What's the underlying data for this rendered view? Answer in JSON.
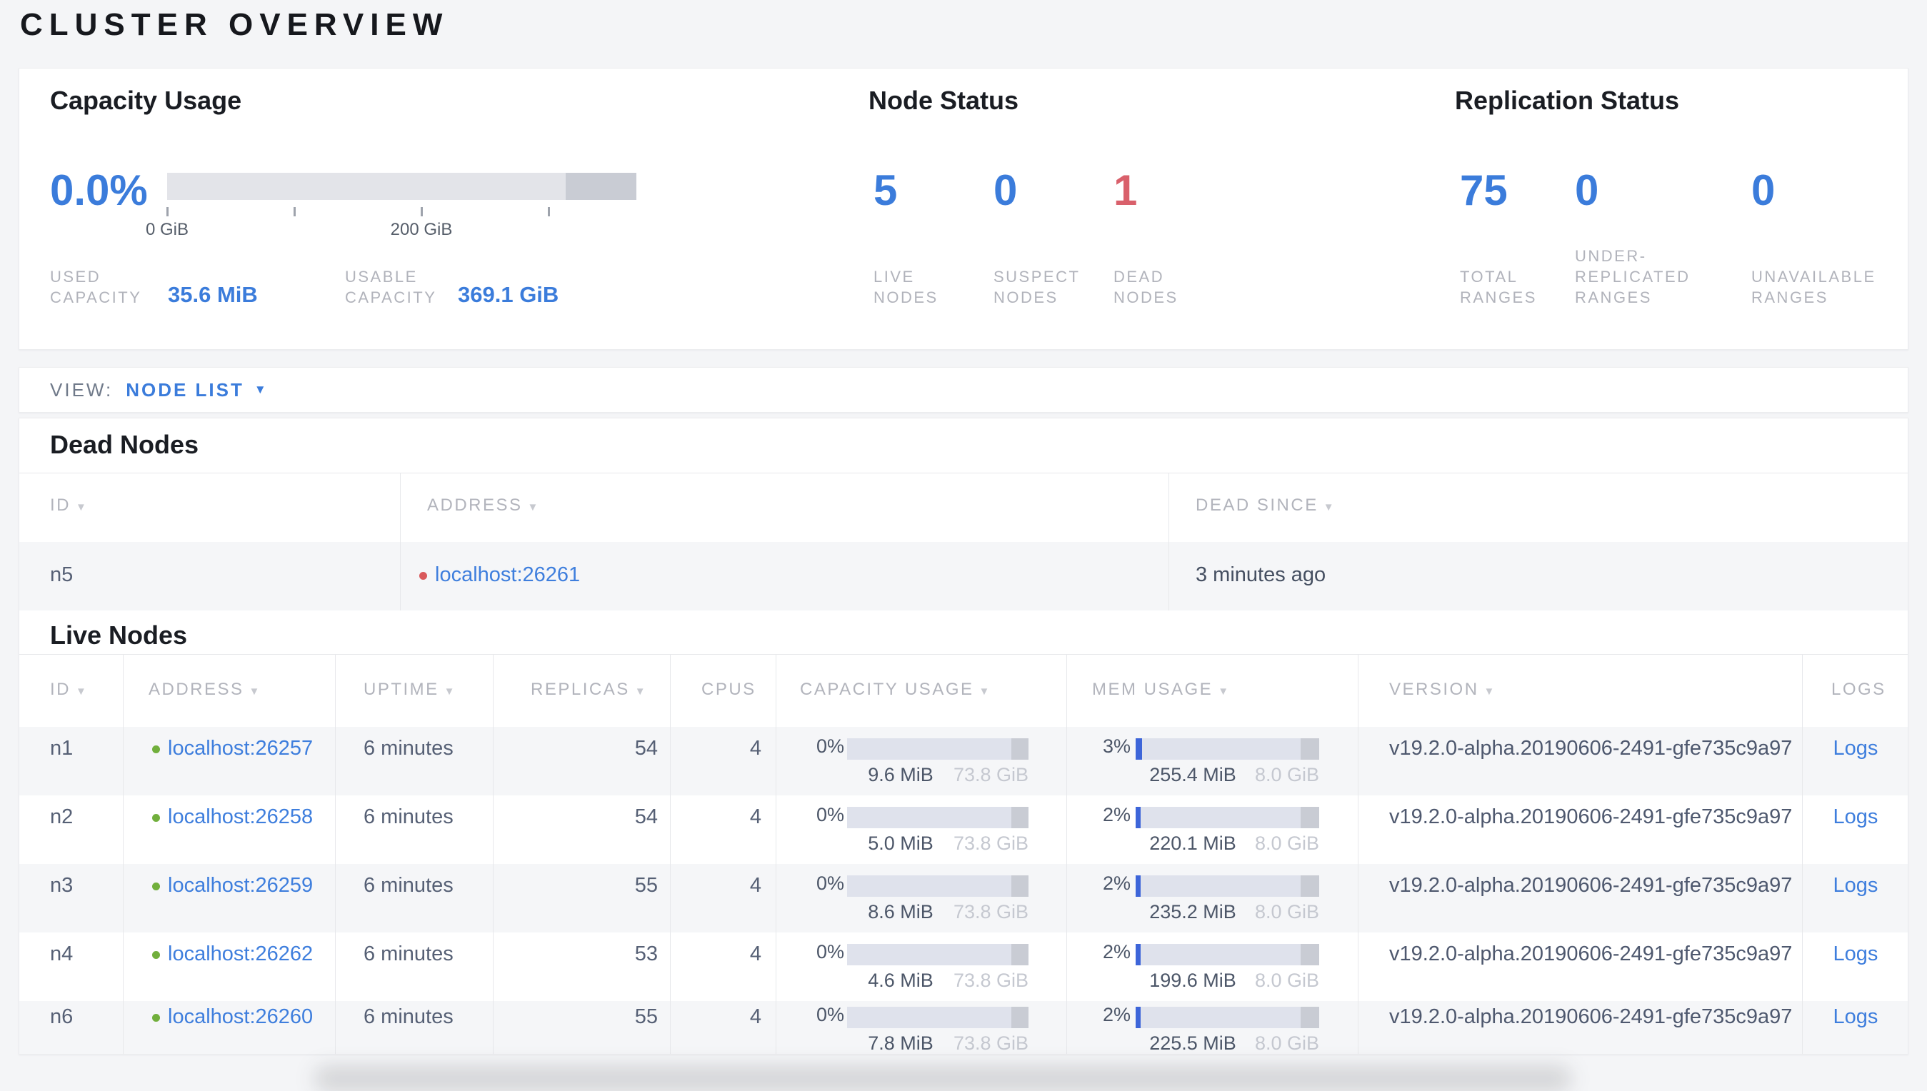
{
  "page": {
    "title": "CLUSTER OVERVIEW"
  },
  "colors": {
    "accent_blue": "#3B7CDB",
    "alert_red": "#D9606B",
    "live_green": "#71AF3C",
    "dead_red": "#D9595C",
    "mem_fill_blue": "#3D65D9"
  },
  "icons": {
    "sort_desc": "▼",
    "dropdown_caret": "▼"
  },
  "overview": {
    "capacity": {
      "title": "Capacity Usage",
      "percent": "0.0%",
      "tick_labels": [
        "0 GiB",
        "200 GiB"
      ],
      "used": {
        "label_lines": [
          "USED",
          "CAPACITY"
        ],
        "value": "35.6 MiB"
      },
      "usable": {
        "label_lines": [
          "USABLE",
          "CAPACITY"
        ],
        "value": "369.1 GiB"
      }
    },
    "node_status": {
      "title": "Node Status",
      "stats": [
        {
          "value": "5",
          "label_lines": [
            "LIVE",
            "NODES"
          ]
        },
        {
          "value": "0",
          "label_lines": [
            "SUSPECT",
            "NODES"
          ]
        },
        {
          "value": "1",
          "label_lines": [
            "DEAD",
            "NODES"
          ]
        }
      ]
    },
    "replication": {
      "title": "Replication Status",
      "stats": [
        {
          "value": "75",
          "label_lines": [
            "TOTAL",
            "RANGES"
          ]
        },
        {
          "value": "0",
          "label_lines": [
            "UNDER-",
            "REPLICATED",
            "RANGES"
          ]
        },
        {
          "value": "0",
          "label_lines": [
            "UNAVAILABLE",
            "RANGES"
          ]
        }
      ]
    }
  },
  "view_bar": {
    "label": "VIEW:",
    "selected": "NODE LIST"
  },
  "dead_nodes": {
    "title": "Dead Nodes",
    "columns": [
      "ID",
      "ADDRESS",
      "DEAD SINCE"
    ],
    "rows": [
      {
        "id": "n5",
        "address": "localhost:26261",
        "dead_since": "3 minutes ago"
      }
    ]
  },
  "live_nodes": {
    "title": "Live Nodes",
    "columns": [
      "ID",
      "ADDRESS",
      "UPTIME",
      "REPLICAS",
      "CPUS",
      "CAPACITY USAGE",
      "MEM USAGE",
      "VERSION",
      "LOGS"
    ],
    "rows": [
      {
        "id": "n1",
        "address": "localhost:26257",
        "uptime": "6 minutes",
        "replicas": "54",
        "cpus": "4",
        "capacity": {
          "pct": "0%",
          "used": "9.6 MiB",
          "total": "73.8 GiB"
        },
        "mem": {
          "pct": "3%",
          "used": "255.4 MiB",
          "total": "8.0 GiB"
        },
        "version": "v19.2.0-alpha.20190606-2491-gfe735c9a97",
        "logs": "Logs"
      },
      {
        "id": "n2",
        "address": "localhost:26258",
        "uptime": "6 minutes",
        "replicas": "54",
        "cpus": "4",
        "capacity": {
          "pct": "0%",
          "used": "5.0 MiB",
          "total": "73.8 GiB"
        },
        "mem": {
          "pct": "2%",
          "used": "220.1 MiB",
          "total": "8.0 GiB"
        },
        "version": "v19.2.0-alpha.20190606-2491-gfe735c9a97",
        "logs": "Logs"
      },
      {
        "id": "n3",
        "address": "localhost:26259",
        "uptime": "6 minutes",
        "replicas": "55",
        "cpus": "4",
        "capacity": {
          "pct": "0%",
          "used": "8.6 MiB",
          "total": "73.8 GiB"
        },
        "mem": {
          "pct": "2%",
          "used": "235.2 MiB",
          "total": "8.0 GiB"
        },
        "version": "v19.2.0-alpha.20190606-2491-gfe735c9a97",
        "logs": "Logs"
      },
      {
        "id": "n4",
        "address": "localhost:26262",
        "uptime": "6 minutes",
        "replicas": "53",
        "cpus": "4",
        "capacity": {
          "pct": "0%",
          "used": "4.6 MiB",
          "total": "73.8 GiB"
        },
        "mem": {
          "pct": "2%",
          "used": "199.6 MiB",
          "total": "8.0 GiB"
        },
        "version": "v19.2.0-alpha.20190606-2491-gfe735c9a97",
        "logs": "Logs"
      },
      {
        "id": "n6",
        "address": "localhost:26260",
        "uptime": "6 minutes",
        "replicas": "55",
        "cpus": "4",
        "capacity": {
          "pct": "0%",
          "used": "7.8 MiB",
          "total": "73.8 GiB"
        },
        "mem": {
          "pct": "2%",
          "used": "225.5 MiB",
          "total": "8.0 GiB"
        },
        "version": "v19.2.0-alpha.20190606-2491-gfe735c9a97",
        "logs": "Logs"
      }
    ]
  },
  "chart_data": {
    "type": "bar",
    "title": "Capacity Usage",
    "percent_used": 0.0,
    "used_capacity": "35.6 MiB",
    "usable_capacity": "369.1 GiB",
    "axis_ticks_gib": [
      0,
      100,
      200,
      300
    ],
    "axis_labeled_ticks": [
      "0 GiB",
      "200 GiB"
    ]
  }
}
